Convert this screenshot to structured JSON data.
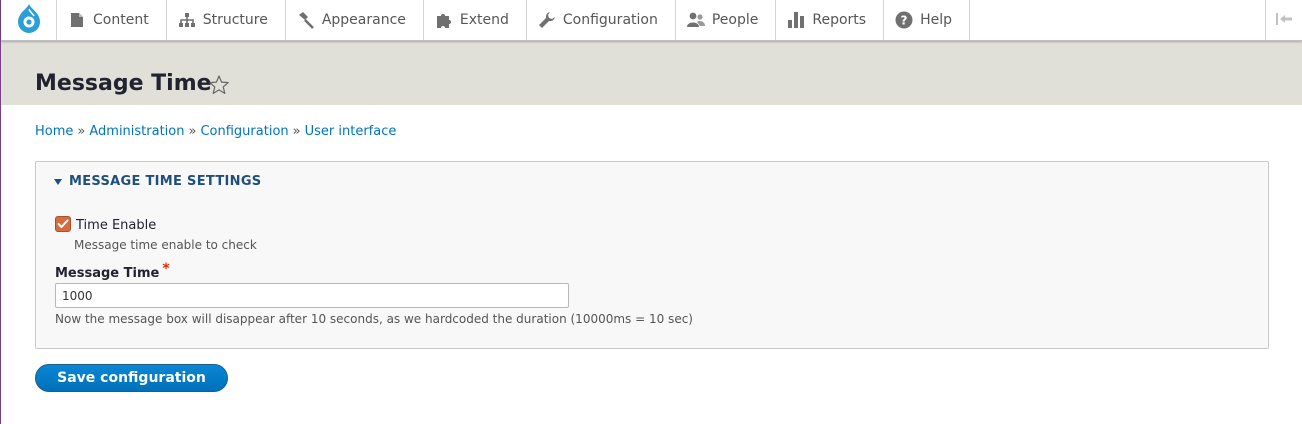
{
  "toolbar": {
    "home_icon": "drupal-logo-icon",
    "items": [
      {
        "label": "Content",
        "icon": "page-icon"
      },
      {
        "label": "Structure",
        "icon": "sitemap-icon"
      },
      {
        "label": "Appearance",
        "icon": "paintbrush-icon"
      },
      {
        "label": "Extend",
        "icon": "puzzle-icon"
      },
      {
        "label": "Configuration",
        "icon": "wrench-icon"
      },
      {
        "label": "People",
        "icon": "people-icon"
      },
      {
        "label": "Reports",
        "icon": "bar-chart-icon"
      },
      {
        "label": "Help",
        "icon": "question-icon"
      }
    ],
    "collapse_icon": "collapse-toolbar-icon"
  },
  "page": {
    "title": "Message Time",
    "star_icon": "star-outline-icon"
  },
  "breadcrumb": {
    "items": [
      "Home",
      "Administration",
      "Configuration",
      "User interface"
    ],
    "separator": "»"
  },
  "form": {
    "legend": "MESSAGE TIME SETTINGS",
    "checkbox": {
      "label": "Time Enable",
      "checked": true,
      "description": "Message time enable to check"
    },
    "message_time": {
      "label": "Message Time",
      "required_mark": "*",
      "value": "1000",
      "description": "Now the message box will disappear after 10 seconds, as we hardcoded the duration (10000ms = 10 sec)"
    },
    "submit_label": "Save configuration"
  },
  "colors": {
    "link": "#0074bd",
    "header_bg": "#e0e0d8",
    "checkbox": "#d96a3c",
    "button": "#0071b8",
    "required": "#e32700"
  }
}
